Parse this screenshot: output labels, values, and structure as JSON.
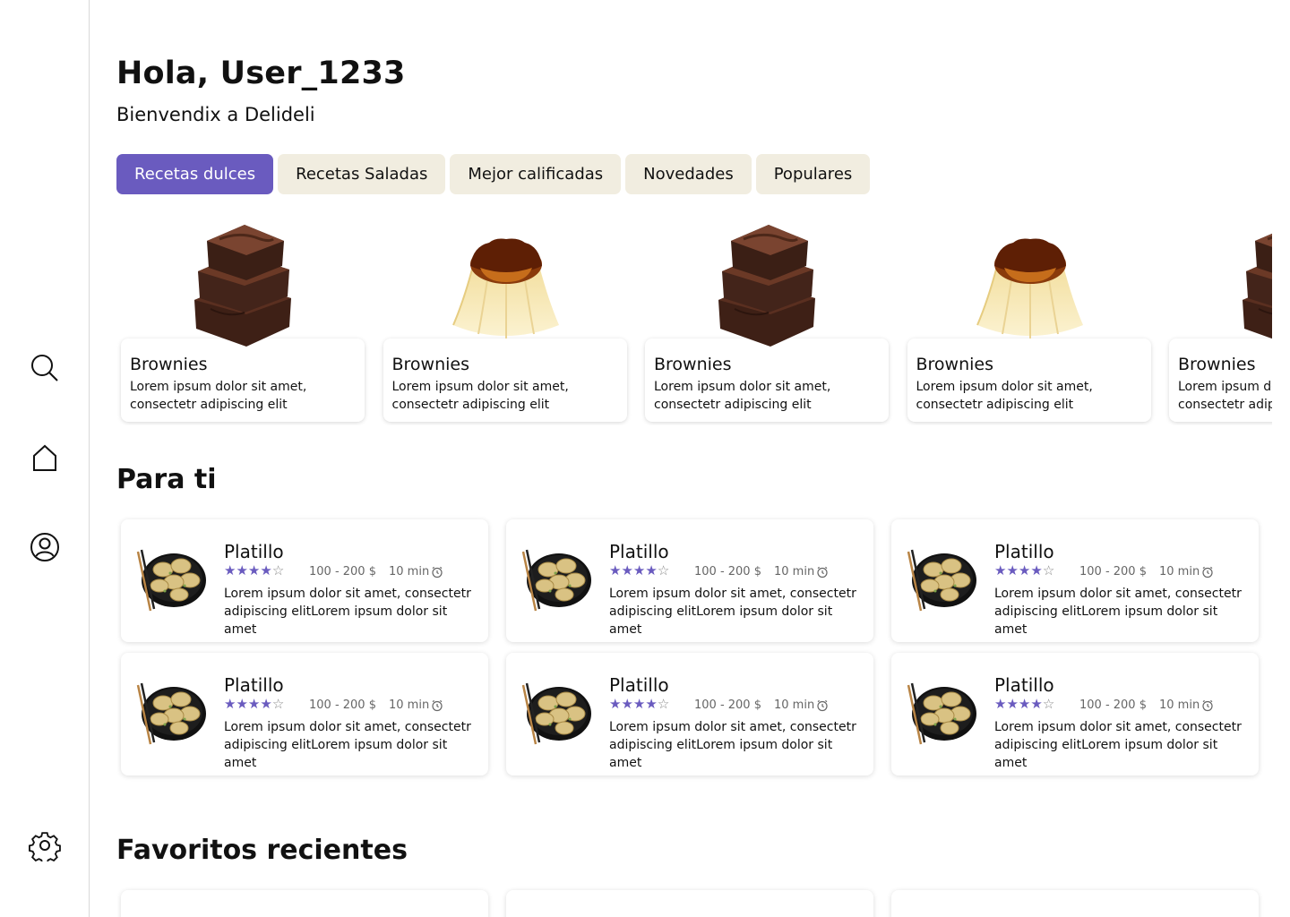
{
  "sidebar": {
    "icons": [
      "search-icon",
      "home-icon",
      "profile-icon",
      "settings-icon"
    ]
  },
  "header": {
    "greeting": "Hola, User_1233",
    "subtitle": "Bienvendix a Delideli"
  },
  "tabs": [
    {
      "label": "Recetas dulces",
      "active": true
    },
    {
      "label": "Recetas Saladas",
      "active": false
    },
    {
      "label": "Mejor calificadas",
      "active": false
    },
    {
      "label": "Novedades",
      "active": false
    },
    {
      "label": "Populares",
      "active": false
    }
  ],
  "recipes": [
    {
      "title": "Brownies",
      "desc1": "Lorem ipsum dolor sit amet,",
      "desc2": "consectetr adipiscing elit",
      "image": "brownie"
    },
    {
      "title": "Brownies",
      "desc1": "Lorem ipsum dolor sit amet,",
      "desc2": "consectetr adipiscing elit",
      "image": "flan"
    },
    {
      "title": "Brownies",
      "desc1": "Lorem ipsum dolor sit amet,",
      "desc2": "consectetr adipiscing elit",
      "image": "brownie"
    },
    {
      "title": "Brownies",
      "desc1": "Lorem ipsum dolor sit amet,",
      "desc2": "consectetr adipiscing elit",
      "image": "flan"
    },
    {
      "title": "Brownies",
      "desc1": "Lorem ipsum dolor sit amet,",
      "desc2": "consectetr adipiscing elit",
      "image": "brownie"
    }
  ],
  "para_ti": {
    "title": "Para ti",
    "items": [
      {
        "title": "Platillo",
        "rating": 4,
        "max_rating": 5,
        "price": "100 - 200 $",
        "time": "10 min",
        "desc": "Lorem ipsum dolor sit amet, consectetr adipiscing elitLorem ipsum dolor sit amet"
      },
      {
        "title": "Platillo",
        "rating": 4,
        "max_rating": 5,
        "price": "100 - 200 $",
        "time": "10 min",
        "desc": "Lorem ipsum dolor sit amet, consectetr adipiscing elitLorem ipsum dolor sit amet"
      },
      {
        "title": "Platillo",
        "rating": 4,
        "max_rating": 5,
        "price": "100 - 200 $",
        "time": "10 min",
        "desc": "Lorem ipsum dolor sit amet, consectetr adipiscing elitLorem ipsum dolor sit amet"
      },
      {
        "title": "Platillo",
        "rating": 4,
        "max_rating": 5,
        "price": "100 - 200 $",
        "time": "10 min",
        "desc": "Lorem ipsum dolor sit amet, consectetr adipiscing elitLorem ipsum dolor sit amet"
      },
      {
        "title": "Platillo",
        "rating": 4,
        "max_rating": 5,
        "price": "100 - 200 $",
        "time": "10 min",
        "desc": "Lorem ipsum dolor sit amet, consectetr adipiscing elitLorem ipsum dolor sit amet"
      },
      {
        "title": "Platillo",
        "rating": 4,
        "max_rating": 5,
        "price": "100 - 200 $",
        "time": "10 min",
        "desc": "Lorem ipsum dolor sit amet, consectetr adipiscing elitLorem ipsum dolor sit amet"
      }
    ]
  },
  "favoritos": {
    "title": "Favoritos recientes"
  },
  "colors": {
    "accent": "#6a5bbf",
    "tab_bg": "#f1ede0"
  }
}
